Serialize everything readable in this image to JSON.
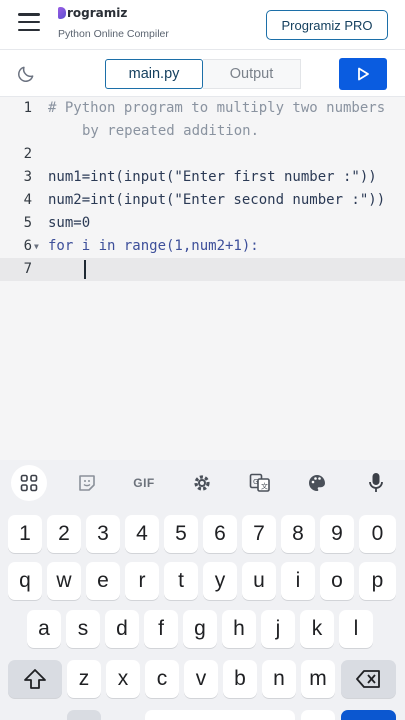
{
  "header": {
    "brand_name": "rogramiz",
    "brand_subtitle": "Python Online Compiler",
    "pro_button": "Programiz PRO"
  },
  "toolbar": {
    "tabs": [
      {
        "label": "main.py",
        "active": true
      },
      {
        "label": "Output",
        "active": false
      }
    ],
    "run_icon": "play-icon",
    "theme_icon": "moon-icon"
  },
  "editor": {
    "lines": [
      {
        "n": "1",
        "text": "# Python program to multiply two numbers"
      },
      {
        "n": "",
        "text": "by repeated addition."
      },
      {
        "n": "2",
        "text": ""
      },
      {
        "n": "3",
        "text": "num1=int(input(\"Enter first number :\"))"
      },
      {
        "n": "4",
        "text": "num2=int(input(\"Enter second number :\"))"
      },
      {
        "n": "5",
        "text": "sum=0"
      },
      {
        "n": "6",
        "text": "for i in range(1,num2+1):"
      },
      {
        "n": "7",
        "text": ""
      }
    ],
    "active_line": "7"
  },
  "keyboard": {
    "tools": [
      "apps-icon",
      "sticker-icon",
      "GIF",
      "gear-icon",
      "translate-icon",
      "palette-icon",
      "mic-icon"
    ],
    "row_numbers": [
      "1",
      "2",
      "3",
      "4",
      "5",
      "6",
      "7",
      "8",
      "9",
      "0"
    ],
    "row1": [
      "q",
      "w",
      "e",
      "r",
      "t",
      "y",
      "u",
      "i",
      "o",
      "p"
    ],
    "row2": [
      "a",
      "s",
      "d",
      "f",
      "g",
      "h",
      "j",
      "k",
      "l"
    ],
    "row3": [
      "z",
      "x",
      "c",
      "v",
      "b",
      "n",
      "m"
    ],
    "shift_icon": "shift-icon",
    "backspace_icon": "backspace-icon"
  },
  "colors": {
    "run_button": "#0a5ce0",
    "accent_border": "#1c6fa8",
    "editor_bg": "#f5f5f6"
  }
}
